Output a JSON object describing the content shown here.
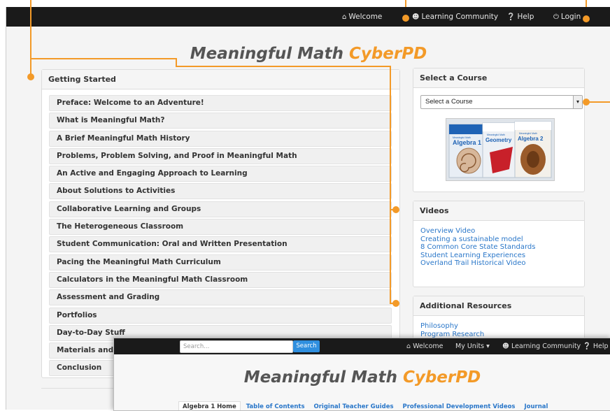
{
  "nav": {
    "welcome": "Welcome",
    "community": "Learning Community",
    "help": "Help",
    "login": "Login"
  },
  "title": {
    "main": "Meaningful Math",
    "accent": "CyberPD"
  },
  "getting_started": {
    "heading": "Getting Started",
    "items": [
      "Preface: Welcome to an Adventure!",
      "What is Meaningful Math?",
      "A Brief Meaningful Math History",
      "Problems, Problem Solving, and Proof in Meaningful Math",
      "An Active and Engaging Approach to Learning",
      "About Solutions to Activities",
      "Collaborative Learning and Groups",
      "The Heterogeneous Classroom",
      "Student Communication: Oral and Written Presentation",
      "Pacing the Meaningful Math Curriculum",
      "Calculators in the Meaningful Math Classroom",
      "Assessment and Grading",
      "Portfolios",
      "Day-to-Day Stuff",
      "Materials and Supplies for the Meaningful Math Classroom",
      "Conclusion"
    ]
  },
  "select_course": {
    "heading": "Select a Course",
    "selected": "Select a Course",
    "books": [
      "Algebra 1",
      "Geometry",
      "Algebra 2"
    ],
    "book_series": "Meaningful Math"
  },
  "videos": {
    "heading": "Videos",
    "links": [
      "Overview Video",
      "Creating a sustainable model",
      "8 Common Core State Standards",
      "Student Learning Experiences",
      "Overland Trail Historical Video"
    ]
  },
  "resources": {
    "heading": "Additional Resources",
    "links": [
      "Philosophy",
      "Program Research"
    ]
  },
  "overlay": {
    "search_placeholder": "Search...",
    "search_button": "Search",
    "welcome": "Welcome",
    "my_units": "My Units",
    "community": "Learning Community",
    "help": "Help",
    "tabs": [
      "Algebra 1 Home",
      "Table of Contents",
      "Original Teacher Guides",
      "Professional Development Videos",
      "Journal"
    ]
  },
  "colors": {
    "accent": "#f39a28",
    "link": "#2a77c9",
    "nav_bg": "#1a1a1a"
  }
}
